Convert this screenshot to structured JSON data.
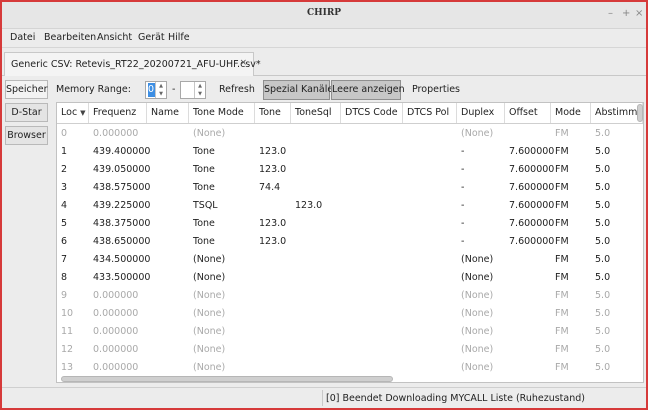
{
  "window": {
    "title": "CHIRP",
    "controls": {
      "minimize": "–",
      "maximize": "+",
      "close": "×"
    }
  },
  "menu": [
    "Datei",
    "Bearbeiten",
    "Ansicht",
    "Gerät",
    "Hilfe"
  ],
  "file_tab": {
    "label": "Generic CSV: Retevis_RT22_20200721_AFU-UHF.csv*",
    "close": "×"
  },
  "side_tabs": [
    "Speicher",
    "D-Star",
    "Browser"
  ],
  "toolbar": {
    "memory_range_label": "Memory Range:",
    "range_start": "0",
    "range_sep": "-",
    "range_end": "",
    "refresh": "Refresh",
    "special_channels": "Spezial Kanäle",
    "show_empty": "Leere anzeigen",
    "properties": "Properties"
  },
  "table": {
    "columns": [
      "Loc",
      "Frequenz",
      "Name",
      "Tone Mode",
      "Tone",
      "ToneSql",
      "DTCS Code",
      "DTCS Pol",
      "Duplex",
      "Offset",
      "Mode",
      "Abstimmun"
    ],
    "sort_icon": "▼",
    "rows": [
      {
        "loc": "0",
        "freq": "0.000000",
        "name": "",
        "tmode": "(None)",
        "tone": "",
        "tsql": "",
        "dcode": "",
        "dpol": "",
        "duplex": "(None)",
        "offset": "",
        "mode": "FM",
        "step": "5.0",
        "empty": true
      },
      {
        "loc": "1",
        "freq": "439.400000",
        "name": "",
        "tmode": "Tone",
        "tone": "123.0",
        "tsql": "",
        "dcode": "",
        "dpol": "",
        "duplex": "-",
        "offset": "7.600000",
        "mode": "FM",
        "step": "5.0",
        "empty": false
      },
      {
        "loc": "2",
        "freq": "439.050000",
        "name": "",
        "tmode": "Tone",
        "tone": "123.0",
        "tsql": "",
        "dcode": "",
        "dpol": "",
        "duplex": "-",
        "offset": "7.600000",
        "mode": "FM",
        "step": "5.0",
        "empty": false
      },
      {
        "loc": "3",
        "freq": "438.575000",
        "name": "",
        "tmode": "Tone",
        "tone": "74.4",
        "tsql": "",
        "dcode": "",
        "dpol": "",
        "duplex": "-",
        "offset": "7.600000",
        "mode": "FM",
        "step": "5.0",
        "empty": false
      },
      {
        "loc": "4",
        "freq": "439.225000",
        "name": "",
        "tmode": "TSQL",
        "tone": "",
        "tsql": "123.0",
        "dcode": "",
        "dpol": "",
        "duplex": "-",
        "offset": "7.600000",
        "mode": "FM",
        "step": "5.0",
        "empty": false
      },
      {
        "loc": "5",
        "freq": "438.375000",
        "name": "",
        "tmode": "Tone",
        "tone": "123.0",
        "tsql": "",
        "dcode": "",
        "dpol": "",
        "duplex": "-",
        "offset": "7.600000",
        "mode": "FM",
        "step": "5.0",
        "empty": false
      },
      {
        "loc": "6",
        "freq": "438.650000",
        "name": "",
        "tmode": "Tone",
        "tone": "123.0",
        "tsql": "",
        "dcode": "",
        "dpol": "",
        "duplex": "-",
        "offset": "7.600000",
        "mode": "FM",
        "step": "5.0",
        "empty": false
      },
      {
        "loc": "7",
        "freq": "434.500000",
        "name": "",
        "tmode": "(None)",
        "tone": "",
        "tsql": "",
        "dcode": "",
        "dpol": "",
        "duplex": "(None)",
        "offset": "",
        "mode": "FM",
        "step": "5.0",
        "empty": false
      },
      {
        "loc": "8",
        "freq": "433.500000",
        "name": "",
        "tmode": "(None)",
        "tone": "",
        "tsql": "",
        "dcode": "",
        "dpol": "",
        "duplex": "(None)",
        "offset": "",
        "mode": "FM",
        "step": "5.0",
        "empty": false
      },
      {
        "loc": "9",
        "freq": "0.000000",
        "name": "",
        "tmode": "(None)",
        "tone": "",
        "tsql": "",
        "dcode": "",
        "dpol": "",
        "duplex": "(None)",
        "offset": "",
        "mode": "FM",
        "step": "5.0",
        "empty": true
      },
      {
        "loc": "10",
        "freq": "0.000000",
        "name": "",
        "tmode": "(None)",
        "tone": "",
        "tsql": "",
        "dcode": "",
        "dpol": "",
        "duplex": "(None)",
        "offset": "",
        "mode": "FM",
        "step": "5.0",
        "empty": true
      },
      {
        "loc": "11",
        "freq": "0.000000",
        "name": "",
        "tmode": "(None)",
        "tone": "",
        "tsql": "",
        "dcode": "",
        "dpol": "",
        "duplex": "(None)",
        "offset": "",
        "mode": "FM",
        "step": "5.0",
        "empty": true
      },
      {
        "loc": "12",
        "freq": "0.000000",
        "name": "",
        "tmode": "(None)",
        "tone": "",
        "tsql": "",
        "dcode": "",
        "dpol": "",
        "duplex": "(None)",
        "offset": "",
        "mode": "FM",
        "step": "5.0",
        "empty": true
      },
      {
        "loc": "13",
        "freq": "0.000000",
        "name": "",
        "tmode": "(None)",
        "tone": "",
        "tsql": "",
        "dcode": "",
        "dpol": "",
        "duplex": "(None)",
        "offset": "",
        "mode": "FM",
        "step": "5.0",
        "empty": true
      }
    ]
  },
  "status": "[0] Beendet Downloading MYCALL Liste (Ruhezustand)"
}
